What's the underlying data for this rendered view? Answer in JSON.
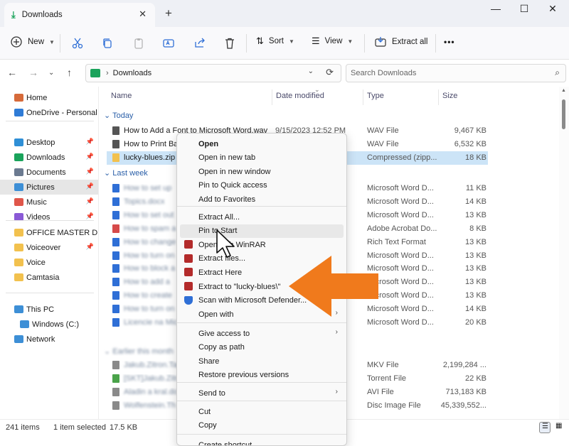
{
  "window": {
    "tab_title": "Downloads",
    "new_tab_glyph": "+",
    "close_tab_glyph": "✕",
    "minimize_glyph": "—",
    "maximize_glyph": "☐",
    "close_glyph": "✕"
  },
  "toolbar": {
    "new_label": "New",
    "sort_label": "Sort",
    "view_label": "View",
    "extract_all_label": "Extract all",
    "more_glyph": "•••",
    "icons": [
      "cut-icon",
      "copy-icon",
      "paste-icon",
      "rename-icon",
      "share-icon",
      "delete-icon"
    ]
  },
  "address": {
    "path": "Downloads",
    "search_placeholder": "Search Downloads"
  },
  "sidebar": {
    "items": [
      {
        "label": "Home",
        "pinned": false,
        "color": "#d66a3a"
      },
      {
        "label": "OneDrive - Personal",
        "pinned": false,
        "color": "#2f7bd6"
      },
      {
        "label": "Desktop",
        "pinned": true,
        "color": "#2f8fd6"
      },
      {
        "label": "Downloads",
        "pinned": true,
        "color": "#1aa35b"
      },
      {
        "label": "Documents",
        "pinned": true,
        "color": "#6b7a90"
      },
      {
        "label": "Pictures",
        "pinned": true,
        "color": "#3d8fd6"
      },
      {
        "label": "Music",
        "pinned": true,
        "color": "#e0564a"
      },
      {
        "label": "Videos",
        "pinned": true,
        "color": "#8a5ad6"
      },
      {
        "label": "OFFICE MASTER D",
        "pinned": false,
        "color": "#f2c14e"
      },
      {
        "label": "Voiceover",
        "pinned": true,
        "color": "#f2c14e"
      },
      {
        "label": "Voice",
        "pinned": false,
        "color": "#f2c14e"
      },
      {
        "label": "Camtasia",
        "pinned": false,
        "color": "#f2c14e"
      },
      {
        "label": "This PC",
        "pinned": false,
        "color": "#3d8fd6"
      },
      {
        "label": "Windows (C:)",
        "pinned": false,
        "color": "#3d8fd6"
      },
      {
        "label": "Network",
        "pinned": false,
        "color": "#3d8fd6"
      }
    ]
  },
  "columns": {
    "name": "Name",
    "date": "Date modified",
    "type": "Type",
    "size": "Size"
  },
  "groups": {
    "today": "Today",
    "last_week": "Last week",
    "earlier": "Earlier this month"
  },
  "rows_today": [
    {
      "name": "How to Add a Font to Microsoft Word.wav",
      "date": "9/15/2023 12:52 PM",
      "type": "WAV File",
      "size": "9,467 KB"
    },
    {
      "name": "How to Print Ba",
      "date": "",
      "type": "WAV File",
      "size": "6,532 KB"
    },
    {
      "name": "lucky-blues.zip",
      "date": "",
      "type": "Compressed (zipp...",
      "size": "18 KB"
    }
  ],
  "rows_last_week": [
    {
      "name": "How to set up",
      "type": "Microsoft Word D...",
      "size": "11 KB",
      "color": "#2f6fd6"
    },
    {
      "name": "Topics.docx",
      "type": "Microsoft Word D...",
      "size": "14 KB",
      "color": "#2f6fd6"
    },
    {
      "name": "How to set out",
      "type": "Microsoft Word D...",
      "size": "13 KB",
      "color": "#2f6fd6"
    },
    {
      "name": "How to spam a",
      "type": "Adobe Acrobat Do...",
      "size": "8 KB",
      "color": "#d64a4a"
    },
    {
      "name": "How to change",
      "type": "Rich Text Format",
      "size": "13 KB",
      "color": "#2f6fd6"
    },
    {
      "name": "How to turn on",
      "type": "Microsoft Word D...",
      "size": "13 KB",
      "color": "#2f6fd6"
    },
    {
      "name": "How to block a",
      "type": "Microsoft Word D...",
      "size": "13 KB",
      "color": "#2f6fd6"
    },
    {
      "name": "How to add a",
      "type": "Microsoft Word D...",
      "size": "13 KB",
      "color": "#2f6fd6"
    },
    {
      "name": "How to create",
      "type": "Microsoft Word D...",
      "size": "13 KB",
      "color": "#2f6fd6"
    },
    {
      "name": "How to turn on",
      "type": "Microsoft Word D...",
      "size": "14 KB",
      "color": "#2f6fd6"
    },
    {
      "name": "Licencie na Mic",
      "type": "Microsoft Word D...",
      "size": "20 KB",
      "color": "#2f6fd6"
    }
  ],
  "rows_earlier": [
    {
      "name": "Jakub.Zitron.Tap",
      "type": "MKV File",
      "size": "2,199,284 ...",
      "color": "#8a8a8a"
    },
    {
      "name": "[SKT]Jakub.Zitr",
      "type": "Torrent File",
      "size": "22 KB",
      "color": "#4aa34a"
    },
    {
      "name": "Aladin a kral.do",
      "type": "AVI File",
      "size": "713,183 KB",
      "color": "#8a8a8a"
    },
    {
      "name": "Wolfenstein.Th",
      "type": "Disc Image File",
      "size": "45,339,552...",
      "color": "#8a8a8a"
    }
  ],
  "status": {
    "items_count": "241 items",
    "selected": "1 item selected",
    "selected_size": "17.5 KB"
  },
  "context_menu": {
    "group1": [
      "Open",
      "Open in new tab",
      "Open in new window",
      "Pin to Quick access",
      "Add to Favorites"
    ],
    "group2": [
      "Extract All...",
      "Pin to Start",
      "Open with WinRAR",
      "Extract files...",
      "Extract Here",
      "Extract to \"lucky-blues\\\"",
      "Scan with Microsoft Defender...",
      "Open with"
    ],
    "group3": [
      "Give access to",
      "Copy as path",
      "Share",
      "Restore previous versions"
    ],
    "group4": [
      "Send to"
    ],
    "group5": [
      "Cut",
      "Copy"
    ],
    "group6": [
      "Create shortcut"
    ]
  },
  "colors": {
    "accent_orange": "#f07a1c",
    "selection_blue": "#cce4f7",
    "group_header_blue": "#2a5fa8"
  }
}
